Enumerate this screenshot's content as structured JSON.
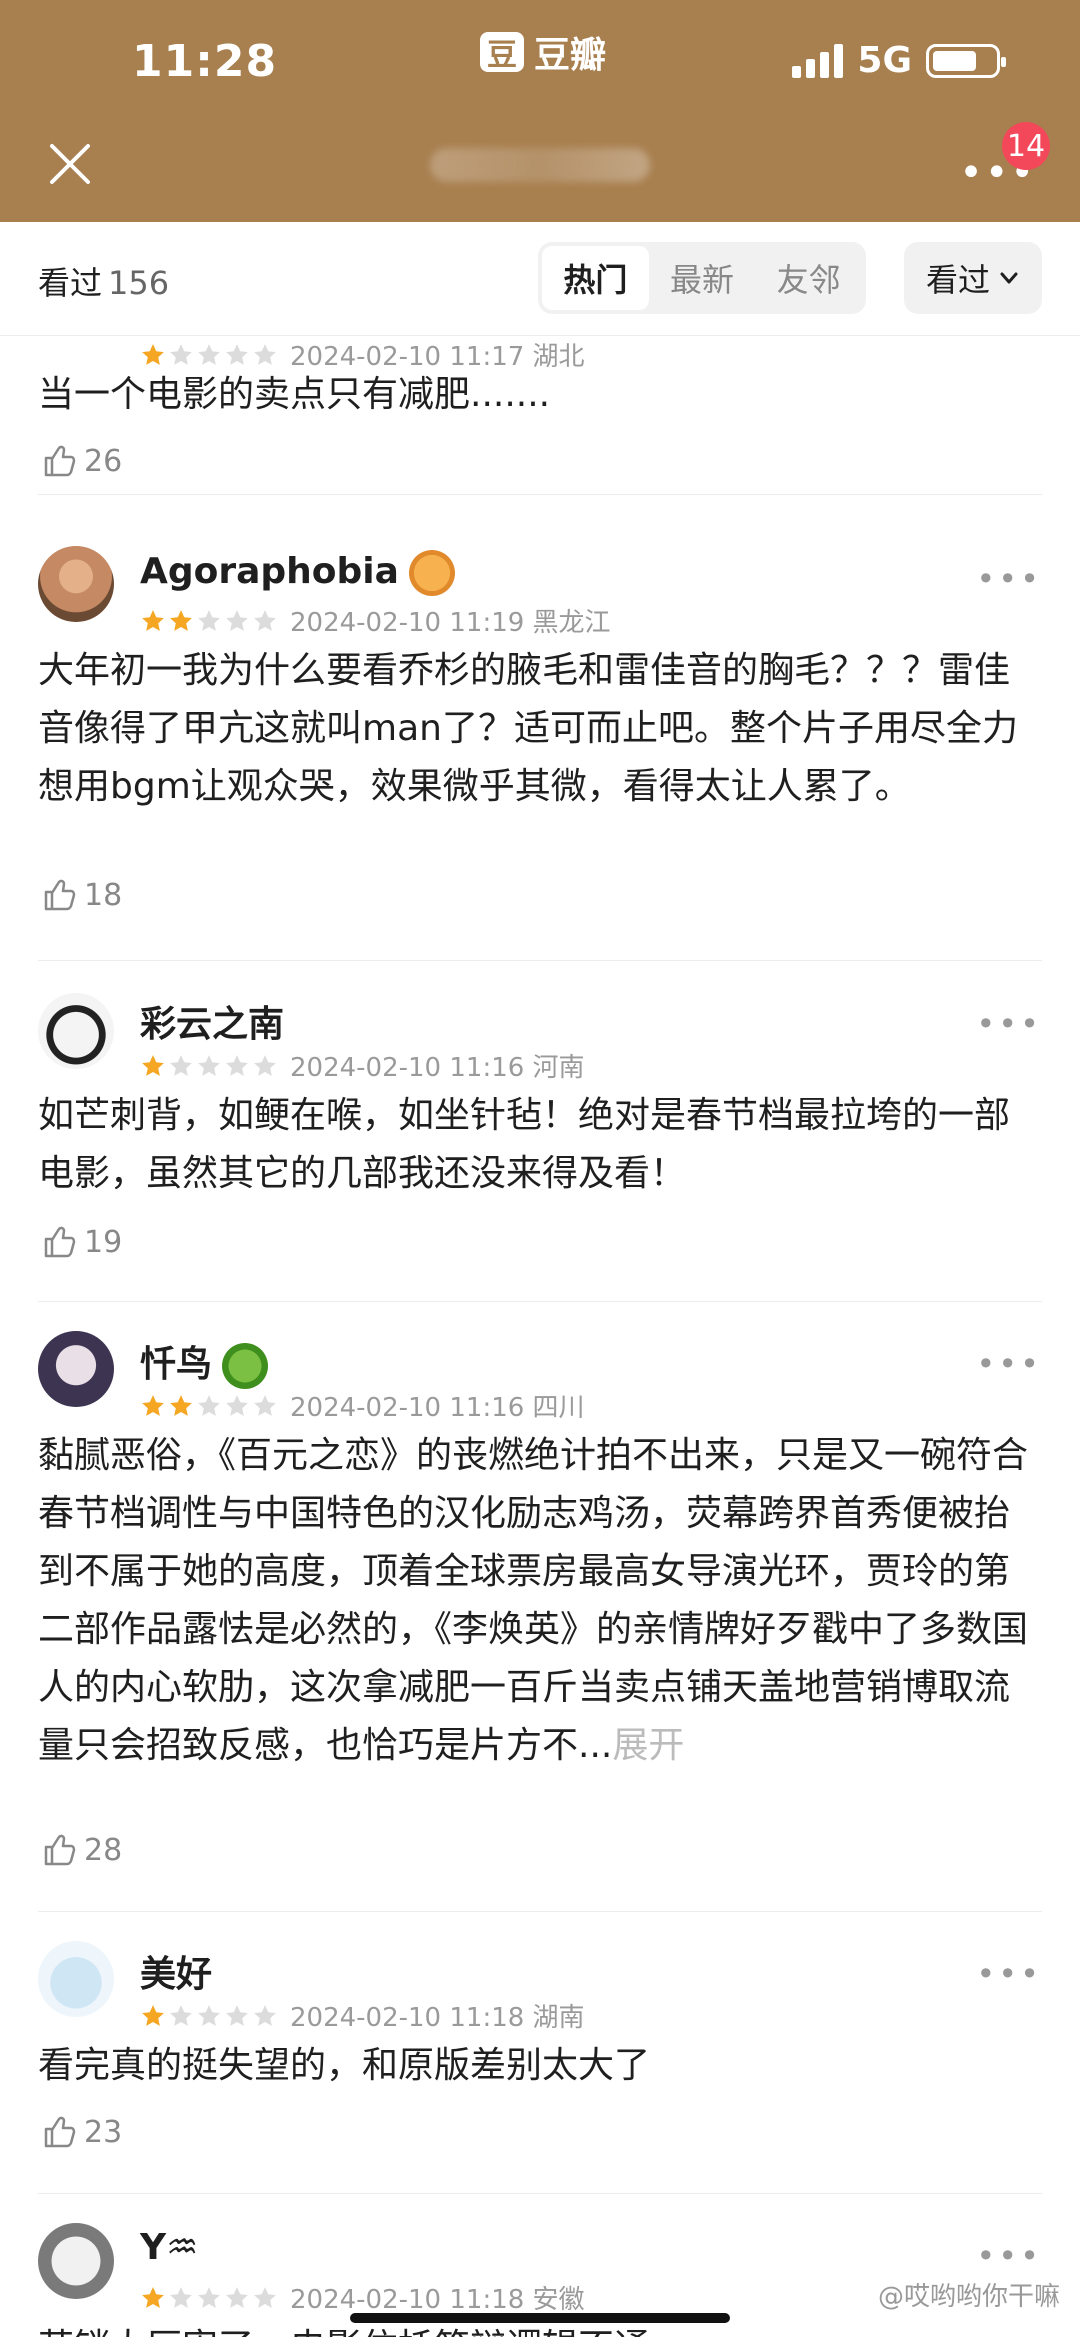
{
  "status": {
    "time": "11:28",
    "app_name": "豆瓣",
    "app_logo": "豆",
    "network": "5G"
  },
  "header": {
    "badge": "14"
  },
  "tabbar": {
    "seen_label": "看过",
    "seen_count": "156",
    "tabs": [
      "热门",
      "最新",
      "友邻"
    ],
    "filter_label": "看过"
  },
  "reviews": [
    {
      "meta": "2024-02-10 11:17 湖北",
      "text": "当一个电影的卖点只有减肥.......",
      "likes": "26",
      "stars": 1
    },
    {
      "name": "Agoraphobia",
      "meta": "2024-02-10 11:19 黑龙江",
      "text": "大年初一我为什么要看乔杉的腋毛和雷佳音的胸毛？？？雷佳音像得了甲亢这就叫man了？适可而止吧。整个片子用尽全力想用bgm让观众哭，效果微乎其微，看得太让人累了。",
      "likes": "18",
      "stars": 2
    },
    {
      "name": "彩云之南",
      "meta": "2024-02-10 11:16 河南",
      "text": "如芒刺背，如鲠在喉，如坐针毡！绝对是春节档最拉垮的一部电影，虽然其它的几部我还没来得及看！",
      "likes": "19",
      "stars": 1
    },
    {
      "name": "忏鸟",
      "meta": "2024-02-10 11:16 四川",
      "text": "黏腻恶俗，《百元之恋》的丧燃绝计拍不出来，只是又一碗符合春节档调性与中国特色的汉化励志鸡汤，荧幕跨界首秀便被抬到不属于她的高度，顶着全球票房最高女导演光环，贾玲的第二部作品露怯是必然的，《李焕英》的亲情牌好歹戳中了多数国人的内心软肋，这次拿减肥一百斤当卖点铺天盖地营销博取流量只会招致反感，也恰巧是片方不...",
      "expand": "展开",
      "likes": "28",
      "stars": 2
    },
    {
      "name": "美好",
      "meta": "2024-02-10 11:18 湖南",
      "text": "看完真的挺失望的，和原版差别太大了",
      "likes": "23",
      "stars": 1
    },
    {
      "name": "Y♒",
      "meta": "2024-02-10 11:18 安徽",
      "text": "营销太厉害了，电影依托答辩逻辑不通",
      "stars": 1
    }
  ],
  "watermark": "@哎哟哟你干嘛",
  "colors": {
    "header_bg": "#a87f4f",
    "star_on": "#f5a623",
    "star_off": "#dcdcdc",
    "badge": "#f2485a"
  }
}
